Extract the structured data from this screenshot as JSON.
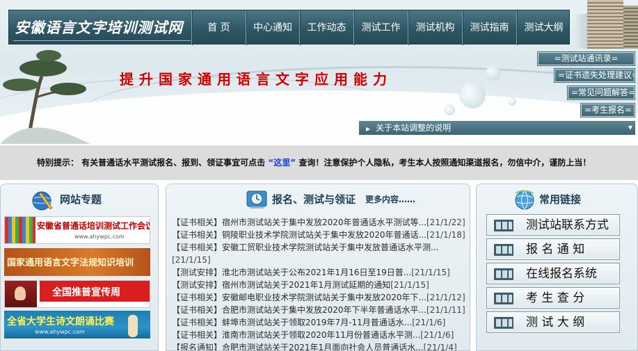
{
  "header": {
    "site_title": "安徽语言文字培训测试网",
    "nav": [
      "首 页",
      "中心通知",
      "工作动态",
      "测试工作",
      "测试机构",
      "测试指南",
      "测试大纲"
    ],
    "slogan": "提升国家通用语言文字应用能力",
    "quick_links": [
      "=测试站通讯录=",
      "=证书遗失处理建议=",
      "=常见问题解答=",
      "=考生报名="
    ],
    "notice_bar": "关于本站调整的说明"
  },
  "tip": {
    "prefix": "特别提示： 有关普通话水平测试报名、报到、领证事宜可点击",
    "link": "“这里”",
    "suffix": " 查询！注意保护个人隐私，考生本人按照通知渠道报名，勿信中介，谨防上当！"
  },
  "topics": {
    "title": "网站专题",
    "banners": [
      {
        "text": "安徽省普通话培训测试工作会议",
        "sub": "www.ahywpc.com"
      },
      {
        "text": "国家通用语言文字法规知识培训",
        "sub": ""
      },
      {
        "text": "全国推普宣传周",
        "sub": ""
      },
      {
        "text": "全省大学生诗文朗诵比赛",
        "sub": "www.ahywpc.com"
      }
    ]
  },
  "news": {
    "title": "报名、测试与领证",
    "more": "更多内容……",
    "items": [
      {
        "cat": "【证书相关】",
        "text": "宿州市测试站关于集中发放2020年普通话水平测试等...",
        "date": "[21/1/22]"
      },
      {
        "cat": "【证书相关】",
        "text": "铜陵职业技术学院测试站关于集中发放2020年普通话...",
        "date": "[21/1/18]"
      },
      {
        "cat": "【证书相关】",
        "text": "安徽工贸职业技术学院测试站关于集中发放普通话水平测...",
        "date": "[21/1/15]"
      },
      {
        "cat": "【测试安排】",
        "text": "淮北市测试站关于公布2021年1月16日至19日普...",
        "date": "[21/1/15]"
      },
      {
        "cat": "【测试安排】",
        "text": "宿州市测试站关于2021年1月测试延期的通知",
        "date": "[21/1/15]"
      },
      {
        "cat": "【证书相关】",
        "text": "安徽邮电职业技术学院测试站关于集中发放2020年下...",
        "date": "[21/1/12]"
      },
      {
        "cat": "【证书相关】",
        "text": "合肥市测试站关于集中发放2020年下半年普通话水平...",
        "date": "[21/1/11]"
      },
      {
        "cat": "【证书相关】",
        "text": "蚌埠市测试站关于领取2019年7月-11月普通话水...",
        "date": "[21/1/6]"
      },
      {
        "cat": "【证书相关】",
        "text": "淮南市测试站关于领取2020年11月份普通话水平测...",
        "date": "[21/1/6]"
      },
      {
        "cat": "【报名通知】",
        "text": "合肥市测试站关于2021年1月面向社会人员普通话水...",
        "date": "[21/1/4]"
      }
    ]
  },
  "links": {
    "title": "常用链接",
    "items": [
      "测试站联系方式",
      "报 名 通 知",
      "在线报名系统",
      "考 生 查 分",
      "测 试 大 纲"
    ]
  },
  "colors": {
    "nav_bar": "#2f5766",
    "slogan": "#d40000",
    "tip_link": "#1a3bd6",
    "panel_bg": "#e6eef2"
  }
}
